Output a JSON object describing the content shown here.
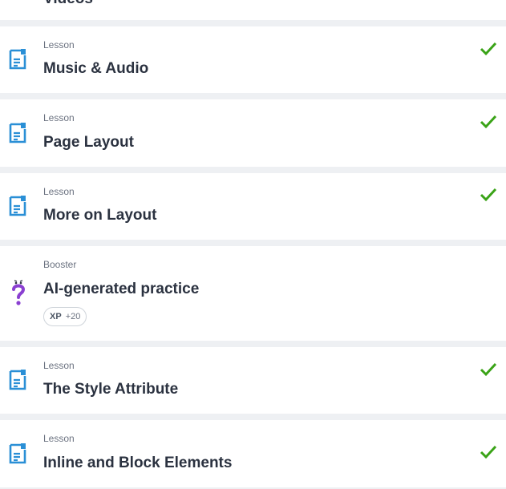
{
  "items": [
    {
      "kind": "",
      "title": "Videos",
      "icon": "lesson-document-icon",
      "completed": false
    },
    {
      "kind": "Lesson",
      "title": "Music & Audio",
      "icon": "lesson-document-icon",
      "completed": true
    },
    {
      "kind": "Lesson",
      "title": "Page Layout",
      "icon": "lesson-document-icon",
      "completed": true
    },
    {
      "kind": "Lesson",
      "title": "More on Layout",
      "icon": "lesson-document-icon",
      "completed": true
    },
    {
      "kind": "Booster",
      "title": "AI-generated practice",
      "icon": "booster-question-icon",
      "completed": false,
      "xp_label": "XP",
      "xp_value": "+20"
    },
    {
      "kind": "Lesson",
      "title": "The Style Attribute",
      "icon": "lesson-document-icon",
      "completed": true
    },
    {
      "kind": "Lesson",
      "title": "Inline and Block Elements",
      "icon": "lesson-document-icon",
      "completed": true
    }
  ],
  "colors": {
    "lesson_icon": "#2a8fd6",
    "check": "#3aa317",
    "booster_icon": "#8a3fd1",
    "background": "#eef0f3"
  }
}
